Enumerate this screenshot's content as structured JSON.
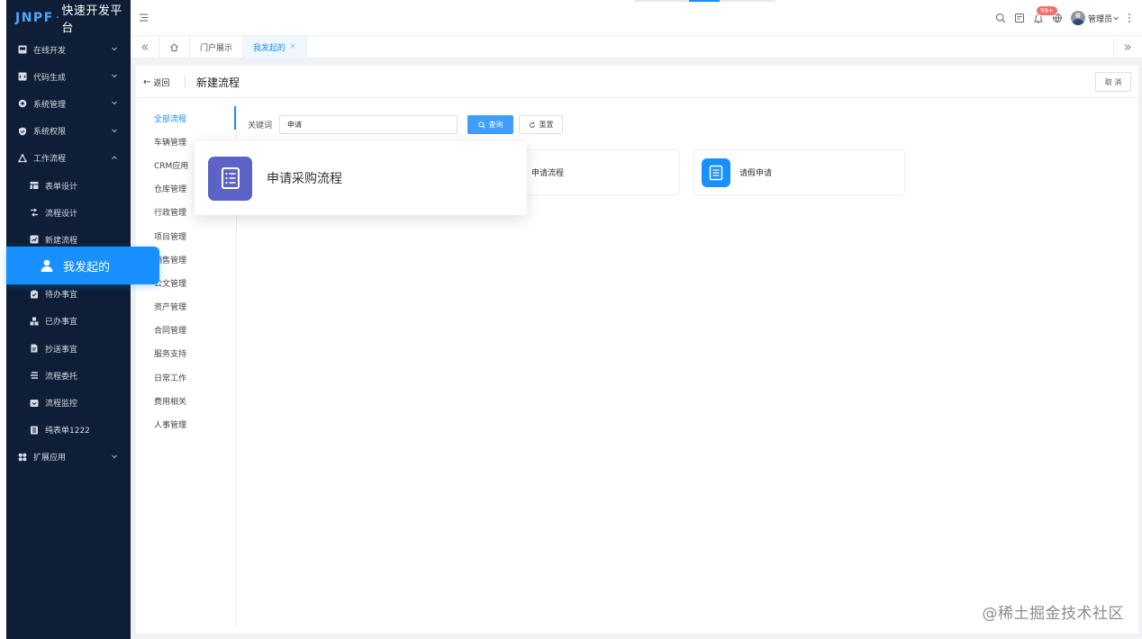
{
  "app": {
    "logo": "JNPF",
    "sep": "·",
    "name": "快速开发平台"
  },
  "sidebar": {
    "items": [
      {
        "label": "在线开发",
        "icon": "monitor-icon",
        "chevron": true
      },
      {
        "label": "代码生成",
        "icon": "code-icon",
        "chevron": true
      },
      {
        "label": "系统管理",
        "icon": "gear-icon",
        "chevron": true
      },
      {
        "label": "系统权限",
        "icon": "shield-icon",
        "chevron": true
      },
      {
        "label": "工作流程",
        "icon": "workflow-icon",
        "chevron": true,
        "expanded": true
      },
      {
        "label": "表单设计",
        "icon": "form-icon",
        "sub": true
      },
      {
        "label": "流程设计",
        "icon": "flow-design-icon",
        "sub": true
      },
      {
        "label": "新建流程",
        "icon": "new-flow-icon",
        "sub": true
      },
      {
        "label": "",
        "icon": "",
        "sub": true,
        "placeholder": true
      },
      {
        "label": "待办事宜",
        "icon": "todo-icon",
        "sub": true
      },
      {
        "label": "已办事宜",
        "icon": "done-icon",
        "sub": true
      },
      {
        "label": "抄送事宜",
        "icon": "cc-icon",
        "sub": true
      },
      {
        "label": "流程委托",
        "icon": "delegate-icon",
        "sub": true
      },
      {
        "label": "流程监控",
        "icon": "monitor-flow-icon",
        "sub": true
      },
      {
        "label": "纯表单1222",
        "icon": "pure-form-icon",
        "sub": true
      },
      {
        "label": "扩展应用",
        "icon": "extend-icon",
        "chevron": true
      }
    ],
    "active": {
      "label": "我发起的",
      "icon": "user-icon"
    }
  },
  "header": {
    "badge": "99+",
    "user": "管理员"
  },
  "tabs": [
    {
      "label": "门户展示"
    },
    {
      "label": "我发起的",
      "close": "×",
      "active": true
    }
  ],
  "page": {
    "back": "返回",
    "title": "新建流程",
    "cancel": "取 消"
  },
  "categories": [
    "全部流程",
    "车辆管理",
    "CRM应用",
    "仓库管理",
    "行政管理",
    "项目管理",
    "销售管理",
    "公文管理",
    "资产管理",
    "合同管理",
    "服务支持",
    "日常工作",
    "费用相关",
    "人事管理"
  ],
  "search": {
    "label": "关键词",
    "value": "申请",
    "query_btn": "查询",
    "reset_btn": "重置"
  },
  "cards": [
    {
      "label": "申请流程",
      "color": "#1890ff"
    },
    {
      "label": "请假申请",
      "color": "#1890ff"
    }
  ],
  "popup": {
    "label": "申请采购流程",
    "color": "#5b63c7"
  },
  "watermark": "@稀土掘金技术社区",
  "colors": {
    "sidebar_bg": "#0d1e36",
    "primary": "#1890ff",
    "query_btn": "#409eff"
  }
}
